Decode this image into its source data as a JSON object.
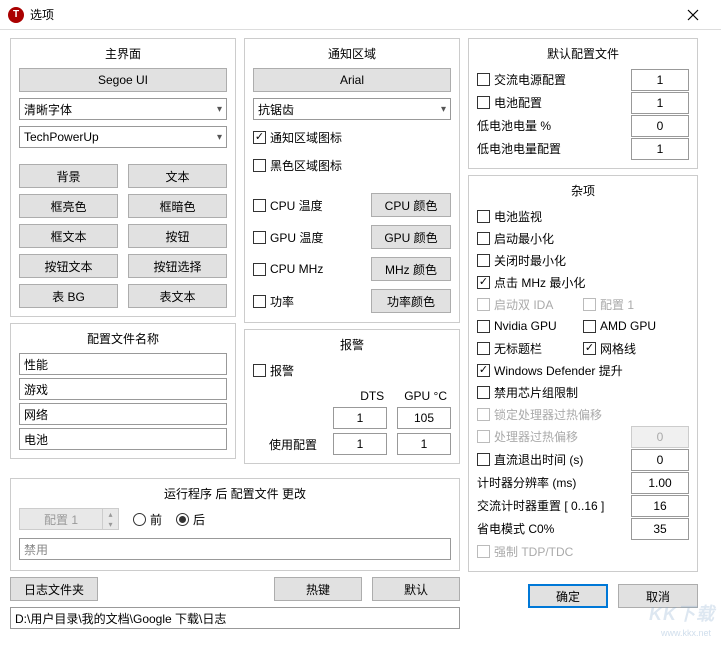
{
  "window": {
    "title": "选项",
    "icon_letter": "T"
  },
  "main_ui": {
    "title": "主界面",
    "font_btn": "Segoe UI",
    "select1": "清晰字体",
    "select2": "TechPowerUp",
    "btns": {
      "bg": "背景",
      "text": "文本",
      "frame_light": "框亮色",
      "frame_dark": "框暗色",
      "frame_text": "框文本",
      "button": "按钮",
      "button_text": "按钮文本",
      "button_sel": "按钮选择",
      "table_bg": "表 BG",
      "table_text": "表文本"
    }
  },
  "profiles": {
    "title": "配置文件名称",
    "p1": "性能",
    "p2": "游戏",
    "p3": "网络",
    "p4": "电池"
  },
  "notify": {
    "title": "通知区域",
    "font_btn": "Arial",
    "aa_select": "抗锯齿",
    "cb_tray": "通知区域图标",
    "cb_black": "黑色区域图标",
    "cb_cpu_temp": "CPU 温度",
    "btn_cpu_color": "CPU 颜色",
    "cb_gpu_temp": "GPU 温度",
    "btn_gpu_color": "GPU 颜色",
    "cb_cpu_mhz": "CPU MHz",
    "btn_mhz_color": "MHz 颜色",
    "cb_power": "功率",
    "btn_power_color": "功率颜色"
  },
  "alarm": {
    "title": "报警",
    "cb_alarm": "报警",
    "hdr_dts": "DTS",
    "hdr_gpu": "GPU °C",
    "row1_v1": "1",
    "row1_v2": "105",
    "row2_label": "使用配置",
    "row2_v1": "1",
    "row2_v2": "1"
  },
  "runchange": {
    "title": "运行程序 后 配置文件 更改",
    "combo": "配置 1",
    "radio_before": "前",
    "radio_after": "后",
    "disabled_txt": "禁用"
  },
  "bottom": {
    "log_folder": "日志文件夹",
    "hotkeys": "热键",
    "defaults": "默认",
    "path": "D:\\用户目录\\我的文档\\Google 下载\\日志"
  },
  "defaults_profile": {
    "title": "默认配置文件",
    "ac": "交流电源配置",
    "ac_v": "1",
    "batt": "电池配置",
    "batt_v": "1",
    "low_pct": "低电池电量 %",
    "low_pct_v": "0",
    "low_cfg": "低电池电量配置",
    "low_cfg_v": "1"
  },
  "misc": {
    "title": "杂项",
    "batt_mon": "电池监视",
    "start_min": "启动最小化",
    "close_min": "关闭时最小化",
    "click_mhz": "点击 MHz 最小化",
    "dual_ida": "启动双 IDA",
    "cfg1": "配置 1",
    "nvidia": "Nvidia GPU",
    "amd": "AMD GPU",
    "no_title": "无标题栏",
    "grid": "网格线",
    "defender": "Windows Defender 提升",
    "chipset": "禁用芯片组限制",
    "lock_offset": "锁定处理器过热偏移",
    "proc_offset": "处理器过热偏移",
    "proc_offset_v": "0",
    "dc_exit": "直流退出时间 (s)",
    "dc_exit_v": "0",
    "timer_res": "计时器分辨率 (ms)",
    "timer_res_v": "1.00",
    "ac_timer": "交流计时器重置 [ 0..16 ]",
    "ac_timer_v": "16",
    "c0_save": "省电模式 C0%",
    "c0_save_v": "35",
    "tdp": "强制 TDP/TDC"
  },
  "footer": {
    "ok": "确定",
    "cancel": "取消"
  },
  "watermark": {
    "big": "KK下载",
    "small": "www.kkx.net"
  }
}
